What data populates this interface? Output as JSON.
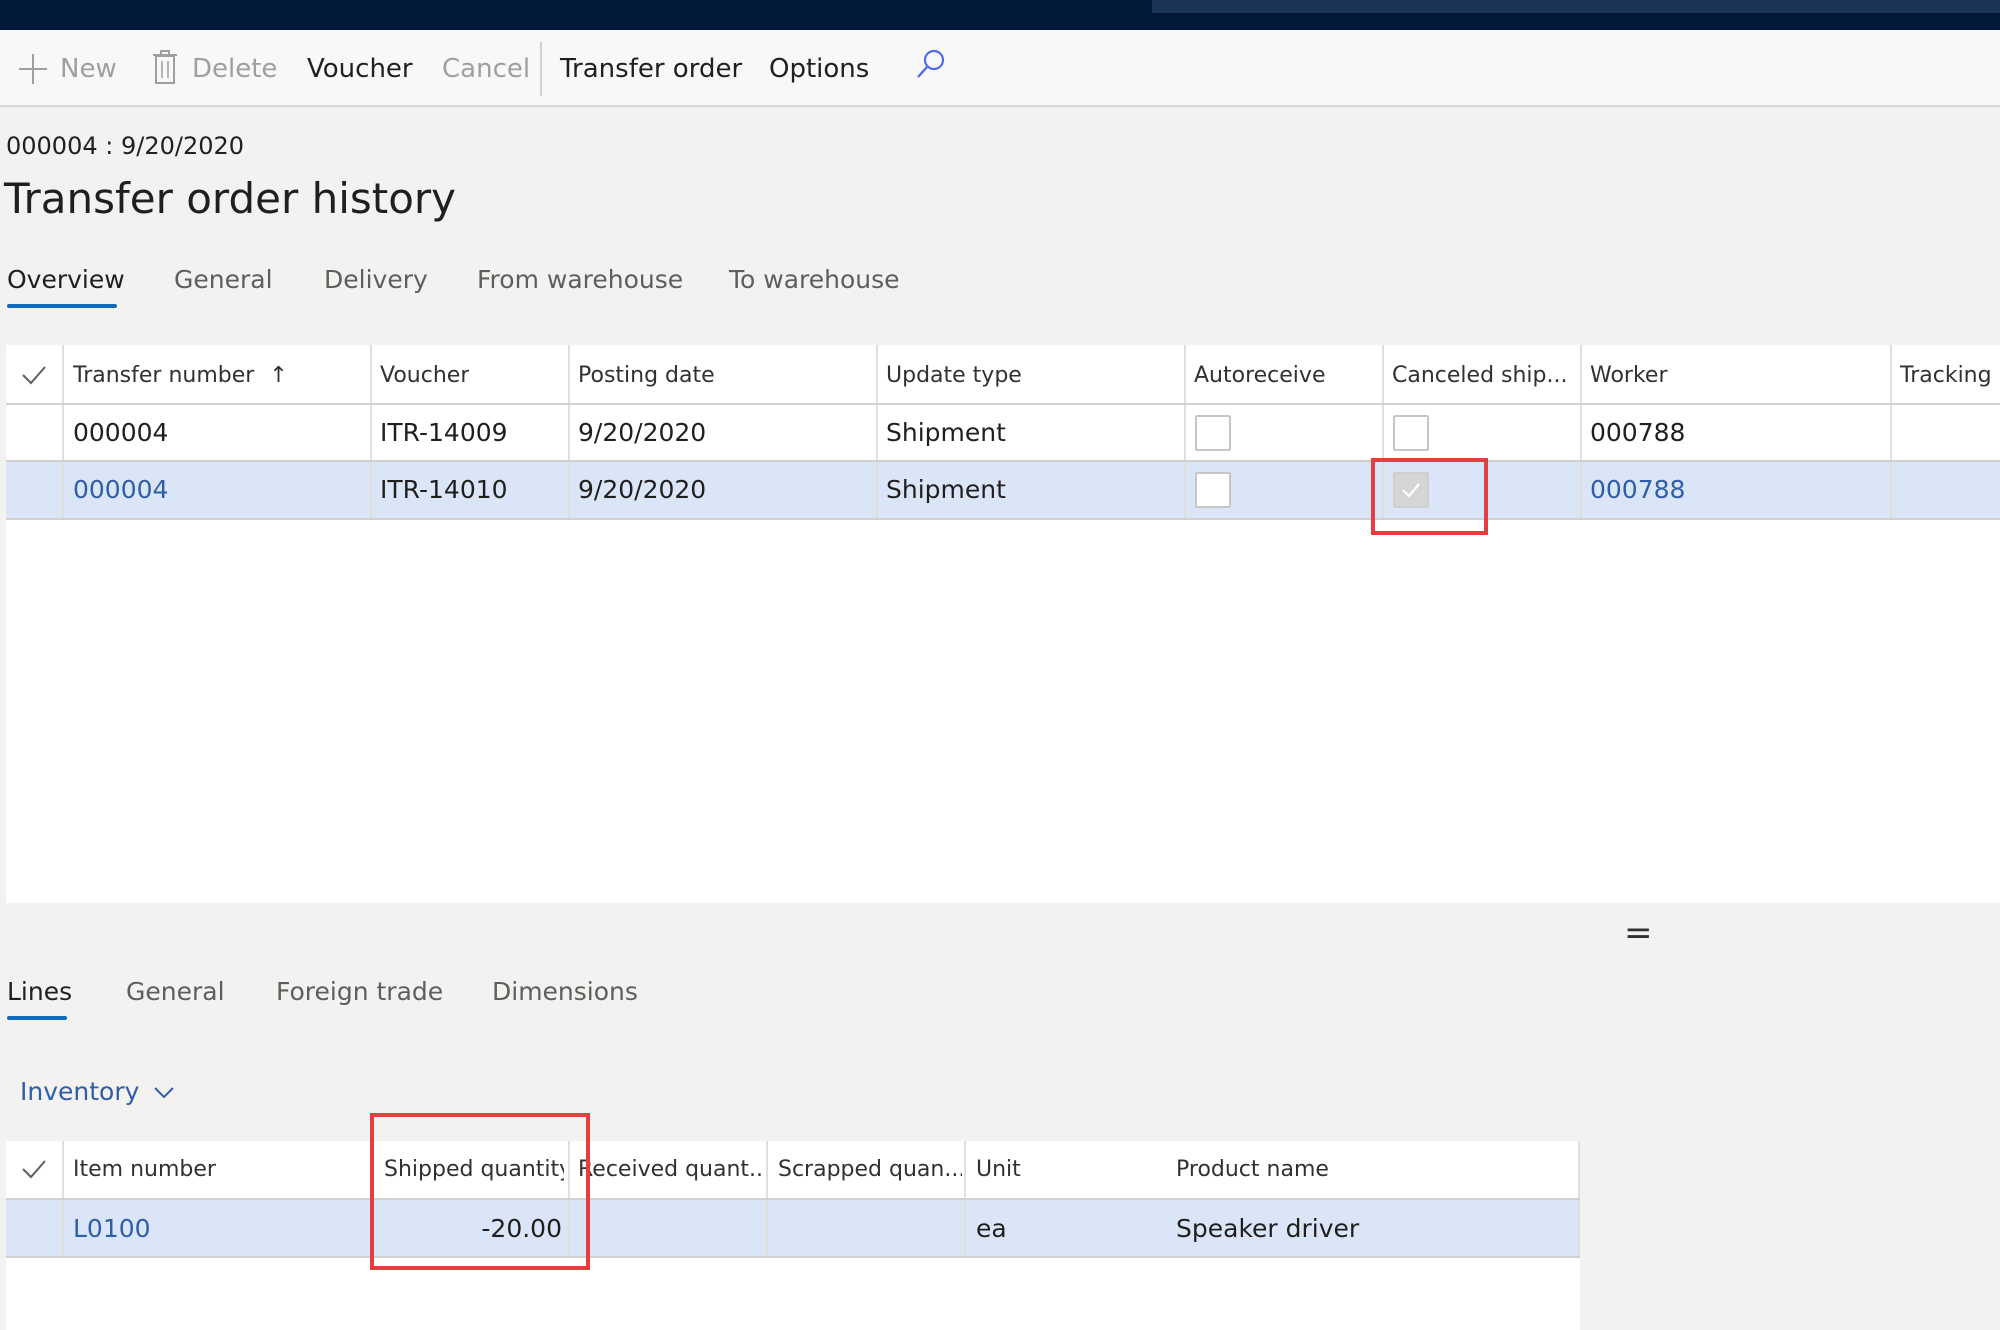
{
  "action_pane": {
    "new_label": "New",
    "delete_label": "Delete",
    "voucher_label": "Voucher",
    "cancel_label": "Cancel",
    "transfer_order_label": "Transfer order",
    "options_label": "Options"
  },
  "header": {
    "breadcrumb": "000004 : 9/20/2020",
    "title": "Transfer order history"
  },
  "tabs": [
    {
      "label": "Overview",
      "active": true
    },
    {
      "label": "General"
    },
    {
      "label": "Delivery"
    },
    {
      "label": "From warehouse"
    },
    {
      "label": "To warehouse"
    }
  ],
  "main_grid": {
    "columns": [
      "Transfer number",
      "Voucher",
      "Posting date",
      "Update type",
      "Autoreceive",
      "Canceled ship...",
      "Worker",
      "Tracking I"
    ],
    "sort_indicator": "↑",
    "rows": [
      {
        "transfer_number": "000004",
        "voucher": "ITR-14009",
        "posting_date": "9/20/2020",
        "update_type": "Shipment",
        "autoreceive": false,
        "canceled_shipment": false,
        "worker": "000788",
        "selected": false
      },
      {
        "transfer_number": "000004",
        "voucher": "ITR-14010",
        "posting_date": "9/20/2020",
        "update_type": "Shipment",
        "autoreceive": false,
        "canceled_shipment": true,
        "worker": "000788",
        "selected": true
      }
    ]
  },
  "splitter_glyph": "=",
  "lines_tabs": [
    {
      "label": "Lines",
      "active": true
    },
    {
      "label": "General"
    },
    {
      "label": "Foreign trade"
    },
    {
      "label": "Dimensions"
    }
  ],
  "inventory_menu": {
    "label": "Inventory"
  },
  "lines_grid": {
    "columns": [
      "Item number",
      "Shipped quantity",
      "Received quant...",
      "Scrapped quan...",
      "Unit",
      "Product name"
    ],
    "rows": [
      {
        "item_number": "L0100",
        "shipped_quantity": "-20.00",
        "received_quantity": "",
        "scrapped_quantity": "",
        "unit": "ea",
        "product_name": "Speaker driver",
        "selected": true
      }
    ]
  },
  "colors": {
    "accent": "#0f6cbd",
    "link": "#2f5ea8",
    "selected_row": "#dbe5f8",
    "highlight_box": "#e53e3e",
    "nav_bar": "#021a3a"
  }
}
